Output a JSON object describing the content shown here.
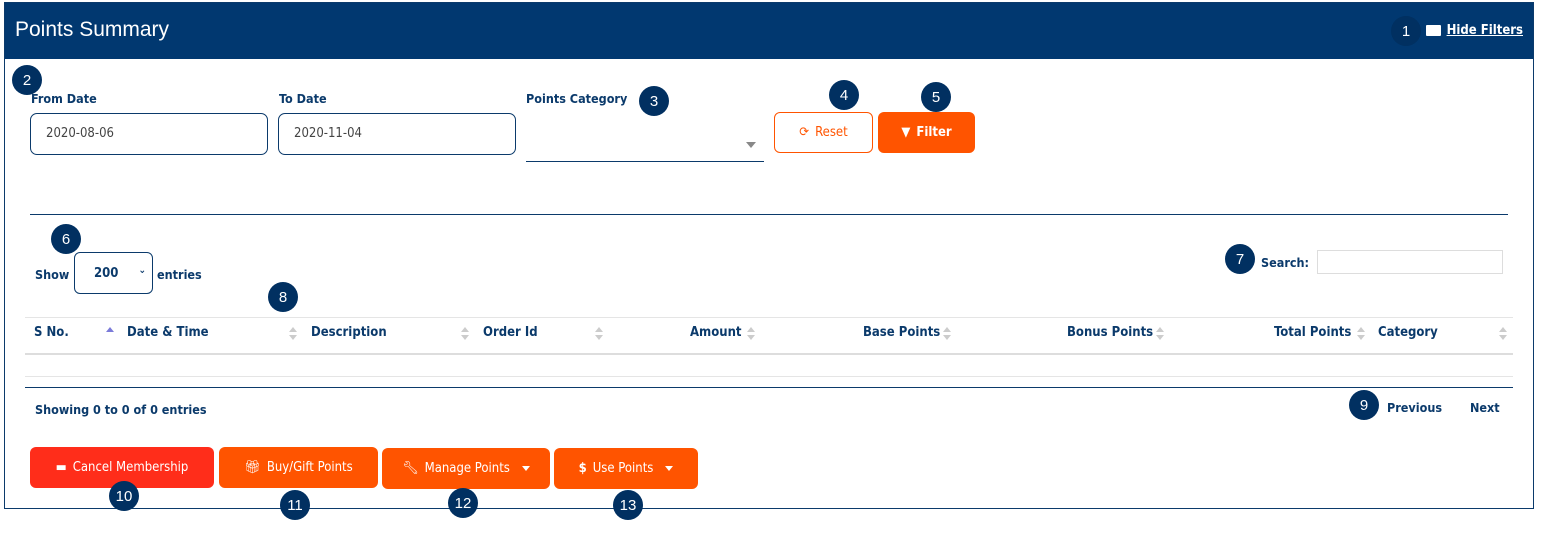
{
  "header": {
    "title": "Points Summary",
    "hide_filters": "Hide Filters"
  },
  "filters": {
    "from_label": "From Date",
    "from_value": "2020-08-06",
    "to_label": "To Date",
    "to_value": "2020-11-04",
    "category_label": "Points Category",
    "category_value": "",
    "reset": "Reset",
    "filter": "Filter"
  },
  "table": {
    "show": "Show",
    "entries_value": "200",
    "entries": "entries",
    "search_label": "Search:",
    "search_value": "",
    "columns": [
      "S No.",
      "Date & Time",
      "Description",
      "Order Id",
      "Amount",
      "Base Points",
      "Bonus Points",
      "Total Points",
      "Category"
    ],
    "info": "Showing 0 to 0 of 0 entries",
    "previous": "Previous",
    "next": "Next"
  },
  "actions": {
    "cancel": "Cancel Membership",
    "buy": "Buy/Gift Points",
    "manage": "Manage Points",
    "use": "Use Points"
  },
  "badges": [
    "1",
    "2",
    "3",
    "4",
    "5",
    "6",
    "7",
    "8",
    "9",
    "10",
    "11",
    "12",
    "13"
  ],
  "colors": {
    "header": "#013870",
    "accent": "#ff5400",
    "danger": "#ff2d1a"
  }
}
